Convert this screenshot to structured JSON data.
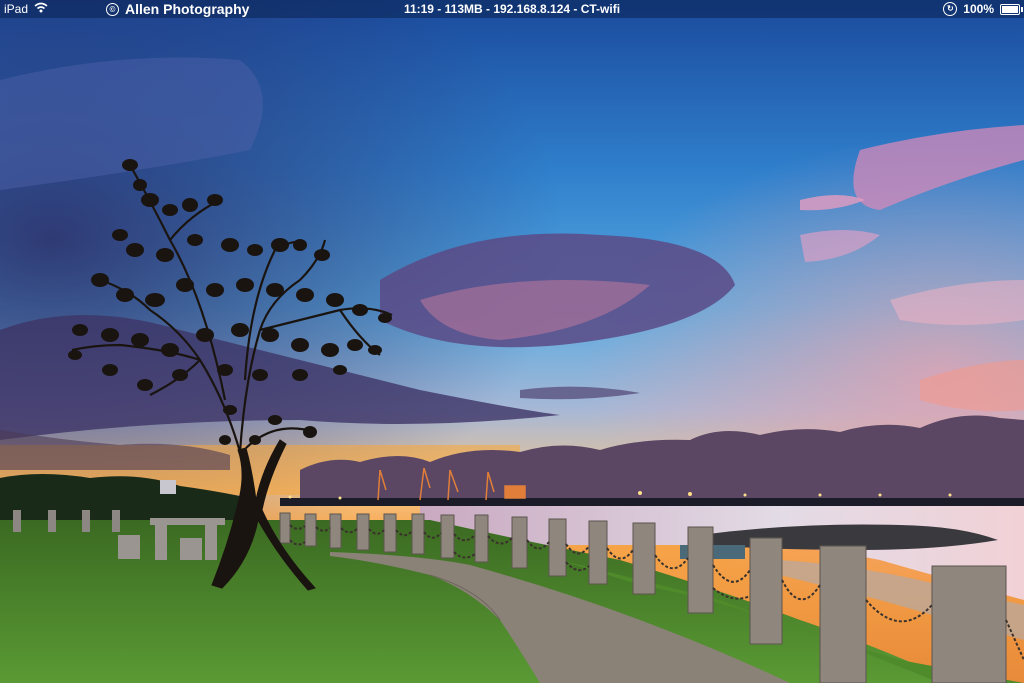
{
  "status_bar": {
    "device": "iPad",
    "info": "11:19 - 113MB - 192.168.8.124 - CT-wifi",
    "battery": "100%"
  },
  "photo": {
    "title": "Allen Photography",
    "copyright_symbol": "©"
  },
  "colors": {
    "sky_top": "#1d4fa3",
    "sky_mid": "#3f97d9",
    "sunset_glow": "#f9b455",
    "cloud_purple": "#5b3c7a",
    "grass": "#4f8a2b",
    "sea": "#d7dbe8"
  }
}
